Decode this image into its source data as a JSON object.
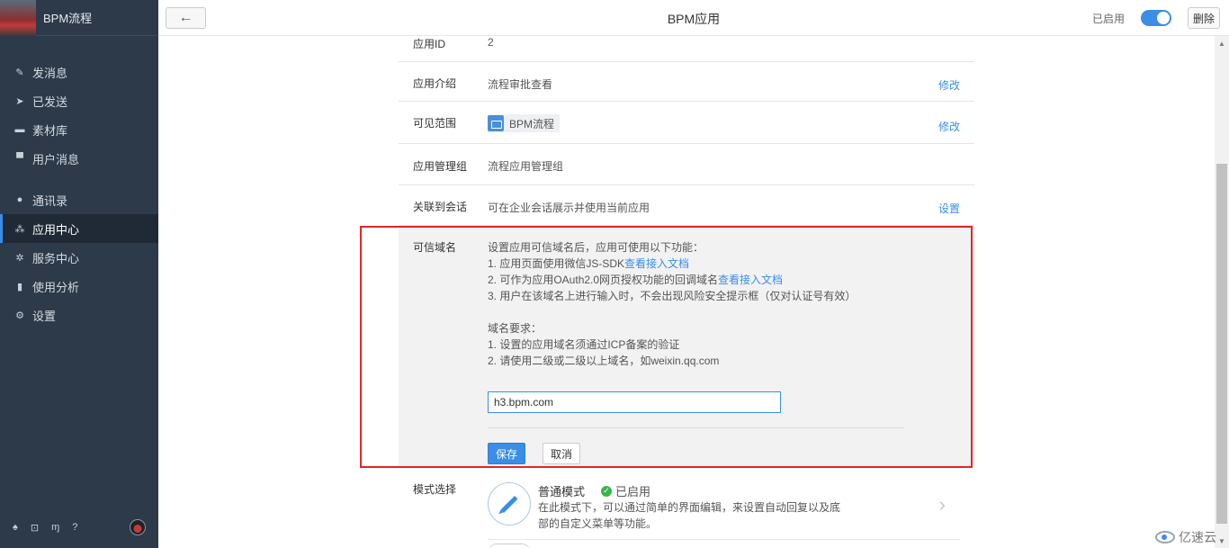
{
  "sidebar": {
    "app_name": "BPM流程",
    "items_top": [
      {
        "label": "发消息",
        "icon": "send-message-icon",
        "glyph": "✎"
      },
      {
        "label": "已发送",
        "icon": "sent-icon",
        "glyph": "➤"
      },
      {
        "label": "素材库",
        "icon": "library-icon",
        "glyph": "▬"
      },
      {
        "label": "用户消息",
        "icon": "chat-icon",
        "glyph": "▀"
      }
    ],
    "items_bottom": [
      {
        "label": "通讯录",
        "icon": "contacts-icon",
        "glyph": "●"
      },
      {
        "label": "应用中心",
        "icon": "apps-icon",
        "glyph": "⁂",
        "active": true
      },
      {
        "label": "服务中心",
        "icon": "service-icon",
        "glyph": "✲"
      },
      {
        "label": "使用分析",
        "icon": "analytics-icon",
        "glyph": "▮"
      },
      {
        "label": "设置",
        "icon": "settings-icon",
        "glyph": "⚙"
      }
    ],
    "footer_icons": [
      {
        "name": "home-icon",
        "glyph": "♠"
      },
      {
        "name": "cart-icon",
        "glyph": "⊡"
      },
      {
        "name": "book-icon",
        "glyph": "ɱ"
      },
      {
        "name": "help-icon",
        "glyph": "?"
      }
    ]
  },
  "topbar": {
    "back_glyph": "←",
    "title": "BPM应用",
    "status_label": "已启用",
    "delete_label": "删除"
  },
  "rows": {
    "id": {
      "label": "应用ID",
      "value": "2"
    },
    "intro": {
      "label": "应用介绍",
      "value": "流程审批查看",
      "action": "修改"
    },
    "scope": {
      "label": "可见范围",
      "tag": "BPM流程",
      "action": "修改"
    },
    "group": {
      "label": "应用管理组",
      "value": "流程应用管理组"
    },
    "conversation": {
      "label": "关联到会话",
      "value": "可在企业会话展示并使用当前应用",
      "action": "设置"
    }
  },
  "domain": {
    "label": "可信域名",
    "intro": "设置应用可信域名后，应用可使用以下功能：",
    "feature1_text": "1. 应用页面使用微信JS-SDK",
    "feature1_link": "查看接入文档",
    "feature2_text": "2. 可作为应用OAuth2.0网页授权功能的回调域名",
    "feature2_link": "查看接入文档",
    "feature3_text": "3. 用户在该域名上进行输入时，不会出现风险安全提示框（仅对认证号有效）",
    "req_title": "域名要求：",
    "req1": "1. 设置的应用域名须通过ICP备案的验证",
    "req2": "2. 请使用二级或二级以上域名，如weixin.qq.com",
    "input_value": "h3.bpm.com",
    "save_label": "保存",
    "cancel_label": "取消"
  },
  "mode": {
    "label": "模式选择",
    "title": "普通模式",
    "status": "已启用",
    "desc": "在此模式下，可以通过简单的界面编辑，来设置自动回复以及底部的自定义菜单等功能。"
  },
  "watermark": "亿速云",
  "colors": {
    "accent": "#3a8ee6",
    "sidebar": "#2c3a4a",
    "highlight_border": "#e0262b",
    "enabled_check": "#3bb54a"
  }
}
